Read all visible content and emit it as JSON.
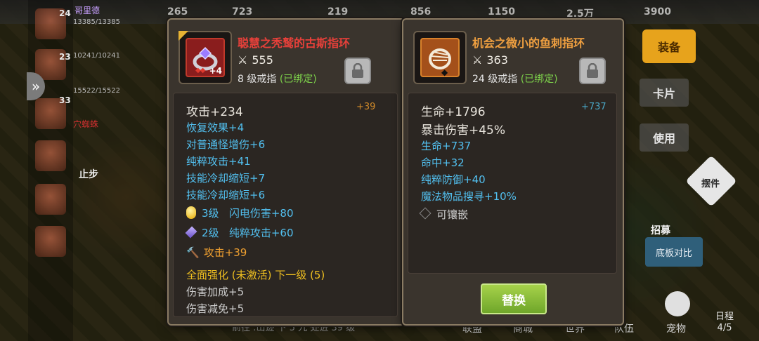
{
  "topbar": {
    "resources": [
      "265",
      "723",
      "219",
      "856",
      "1150",
      "2.5万",
      "3900"
    ]
  },
  "side": {
    "name": "哥里德",
    "rows": [
      {
        "level": "24",
        "hp": "13385/13385"
      },
      {
        "level": "23",
        "hp": "10241/10241"
      },
      {
        "level": "",
        "hp": "15522/15522"
      },
      {
        "level": "33",
        "hp": ""
      }
    ],
    "status_red": "穴蜘蛛",
    "stop_label": "止步"
  },
  "right_menu": {
    "equip": "装备",
    "card": "卡片",
    "use": "使用",
    "ornament": "摆件",
    "recruit": "招募",
    "compare": "底板对比",
    "schedule": "日程",
    "schedule_count": "4/5"
  },
  "bottom": {
    "status": "前往 :山迹   下 5 九 处进 39 级",
    "tabs": [
      "联盟",
      "商城",
      "世界",
      "队伍",
      "宠物"
    ]
  },
  "left_item": {
    "name": "聪慧之秃鹫的古斯指环",
    "power": "555",
    "enhance": "+4",
    "level": "8 级戒指",
    "bound": "(已绑定)",
    "main_stat": "攻击+234",
    "main_delta": "+39",
    "sub_stats": [
      "恢复效果+4",
      "对普通怪增伤+6",
      "纯粹攻击+41",
      "技能冷却缩短+7",
      "技能冷却缩短+6"
    ],
    "gems": [
      {
        "level": "3级",
        "effect": "闪电伤害+80",
        "color": "yellow"
      },
      {
        "level": "2级",
        "effect": "纯粹攻击+60",
        "color": "purple"
      }
    ],
    "enchant": "攻击+39",
    "set_title": "全面强化 (未激活) 下一级 (5)",
    "set_effects": [
      "伤害加成+5",
      "伤害减免+5"
    ]
  },
  "right_item": {
    "name": "机会之微小的鱼刺指环",
    "power": "363",
    "level": "24 级戒指",
    "bound": "(已绑定)",
    "main_stats": [
      "生命+1796",
      "暴击伤害+45%"
    ],
    "main_delta": "+737",
    "sub_stats": [
      "生命+737",
      "命中+32",
      "纯粹防御+40",
      "魔法物品搜寻+10%"
    ],
    "socket": "可镶嵌",
    "replace_label": "替换"
  },
  "colors": {
    "panel_bg": "#3a342d",
    "legendary_name": "#e8403a",
    "epic_name": "#f0a040",
    "stat_cyan": "#52c0f0",
    "bound_green": "#7ccf4a",
    "replace_green": "#8cc23a"
  }
}
